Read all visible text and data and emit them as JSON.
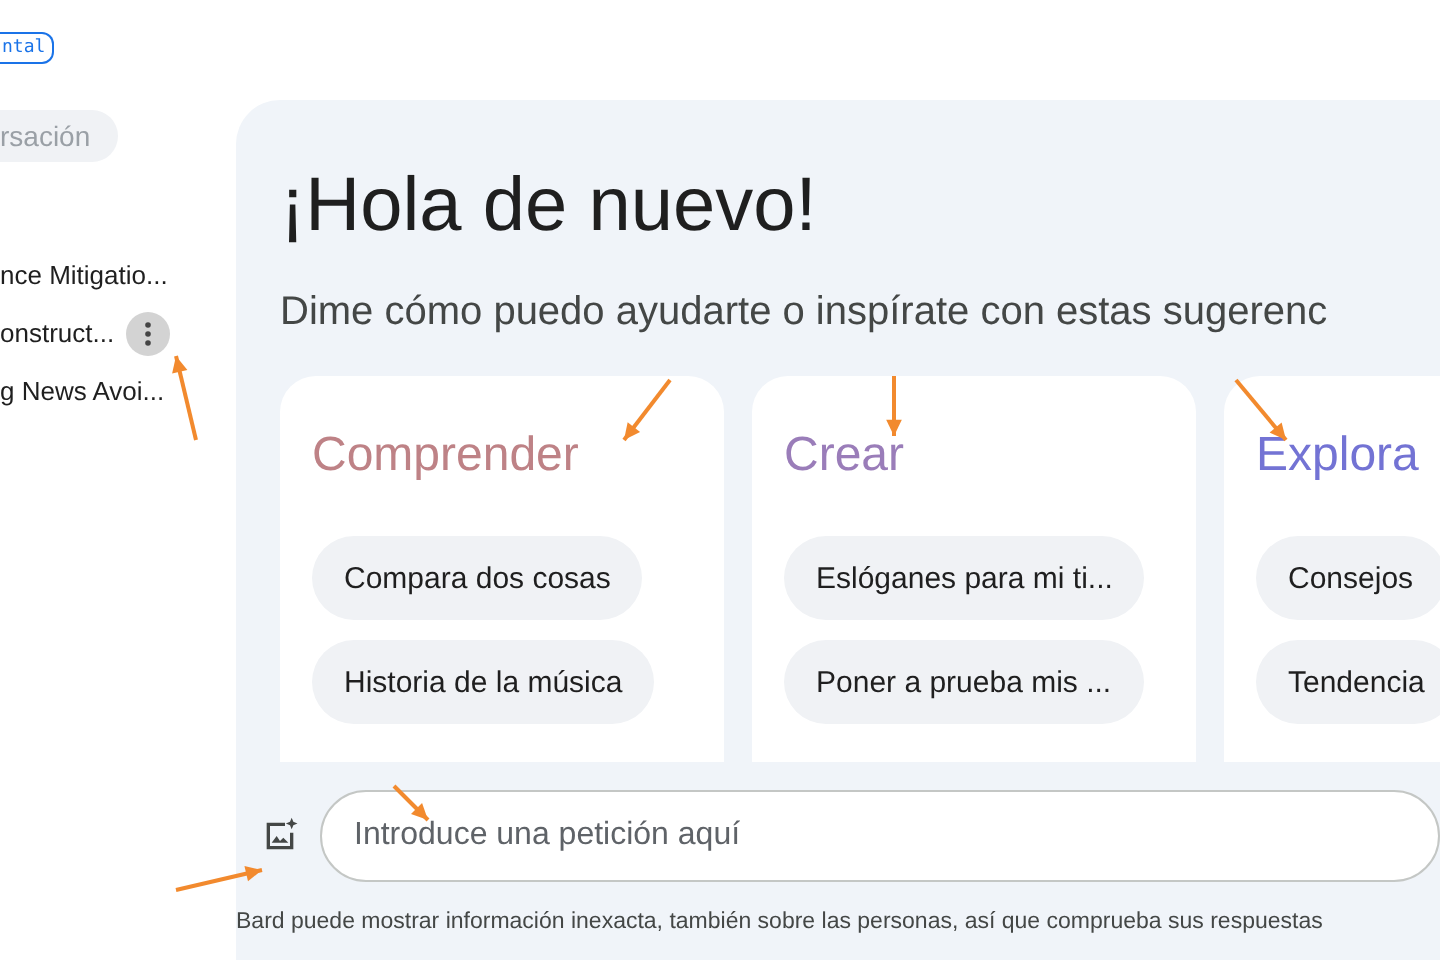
{
  "sidebar": {
    "badge": "ntal",
    "new_chat": "rsación",
    "items": [
      {
        "label": "nce Mitigatio...",
        "selected": false
      },
      {
        "label": "onstruct...",
        "selected": true
      },
      {
        "label": "g News Avoi...",
        "selected": false
      }
    ]
  },
  "main": {
    "title": "¡Hola de nuevo!",
    "subtitle": "Dime cómo puedo ayudarte o inspírate con estas sugerenc",
    "cards": [
      {
        "heading": "Comprender",
        "color": "#be8286",
        "chips": [
          "Compara dos cosas",
          "Historia de la música"
        ]
      },
      {
        "heading": "Crear",
        "color": "#9a7db9",
        "chips": [
          "Eslóganes para mi ti...",
          "Poner a prueba mis ..."
        ]
      },
      {
        "heading": "Explora",
        "color": "#7373d4",
        "chips": [
          "Consejos",
          "Tendencia"
        ]
      }
    ],
    "prompt": {
      "placeholder": "Introduce una petición aquí"
    },
    "disclaimer": "Bard puede mostrar información inexacta, también sobre las personas, así que comprueba sus respuestas"
  }
}
